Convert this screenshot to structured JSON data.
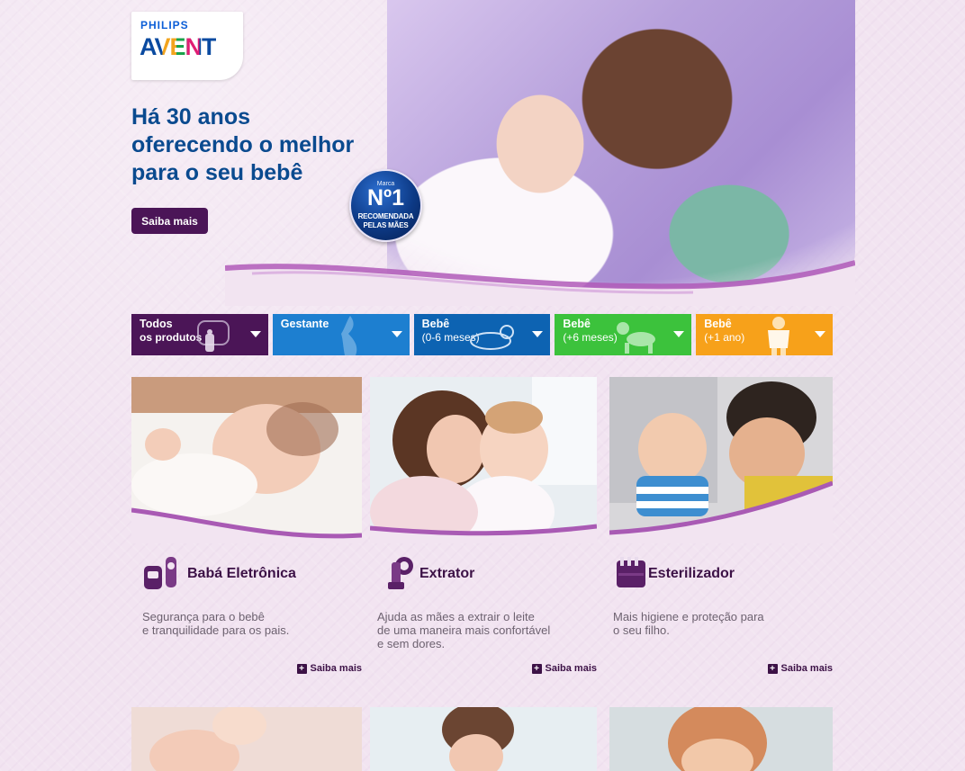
{
  "hero": {
    "brand_top": "PHILIPS",
    "brand_main": "AVENT",
    "title": "Há 30 anos\noferecendo o melhor\npara o seu bebê",
    "cta": "Saiba mais",
    "badge": {
      "marca": "Marca",
      "number": "Nº1",
      "line1": "RECOMENDADA",
      "line2": "PELAS MÃES"
    }
  },
  "categories": [
    {
      "title": "Todos",
      "subtitle": "os produtos",
      "color": "#4b1557"
    },
    {
      "title": "Gestante",
      "subtitle": "",
      "color": "#1d7fd0"
    },
    {
      "title": "Bebê",
      "subtitle": "(0-6 meses)",
      "color": "#0d63b2"
    },
    {
      "title": "Bebê",
      "subtitle": "(+6 meses)",
      "color": "#3cc23c"
    },
    {
      "title": "Bebê",
      "subtitle": "(+1 ano)",
      "color": "#f7a11a"
    }
  ],
  "cards": [
    {
      "name": "Babá Eletrônica",
      "icon": "baby-monitor-icon",
      "description": "Segurança para o bebê\ne tranquilidade para os pais.",
      "more": "Saiba mais"
    },
    {
      "name": "Extrator",
      "icon": "breast-pump-icon",
      "description": "Ajuda as mães a extrair o leite\nde uma maneira mais confortável\ne sem dores.",
      "more": "Saiba mais"
    },
    {
      "name": "Esterilizador",
      "icon": "sterilizer-icon",
      "description": "Mais higiene e proteção para\no seu filho.",
      "more": "Saiba mais"
    }
  ],
  "colors": {
    "accent": "#4b1557",
    "title_blue": "#0a4a8f",
    "background": "#f2e4f1"
  }
}
